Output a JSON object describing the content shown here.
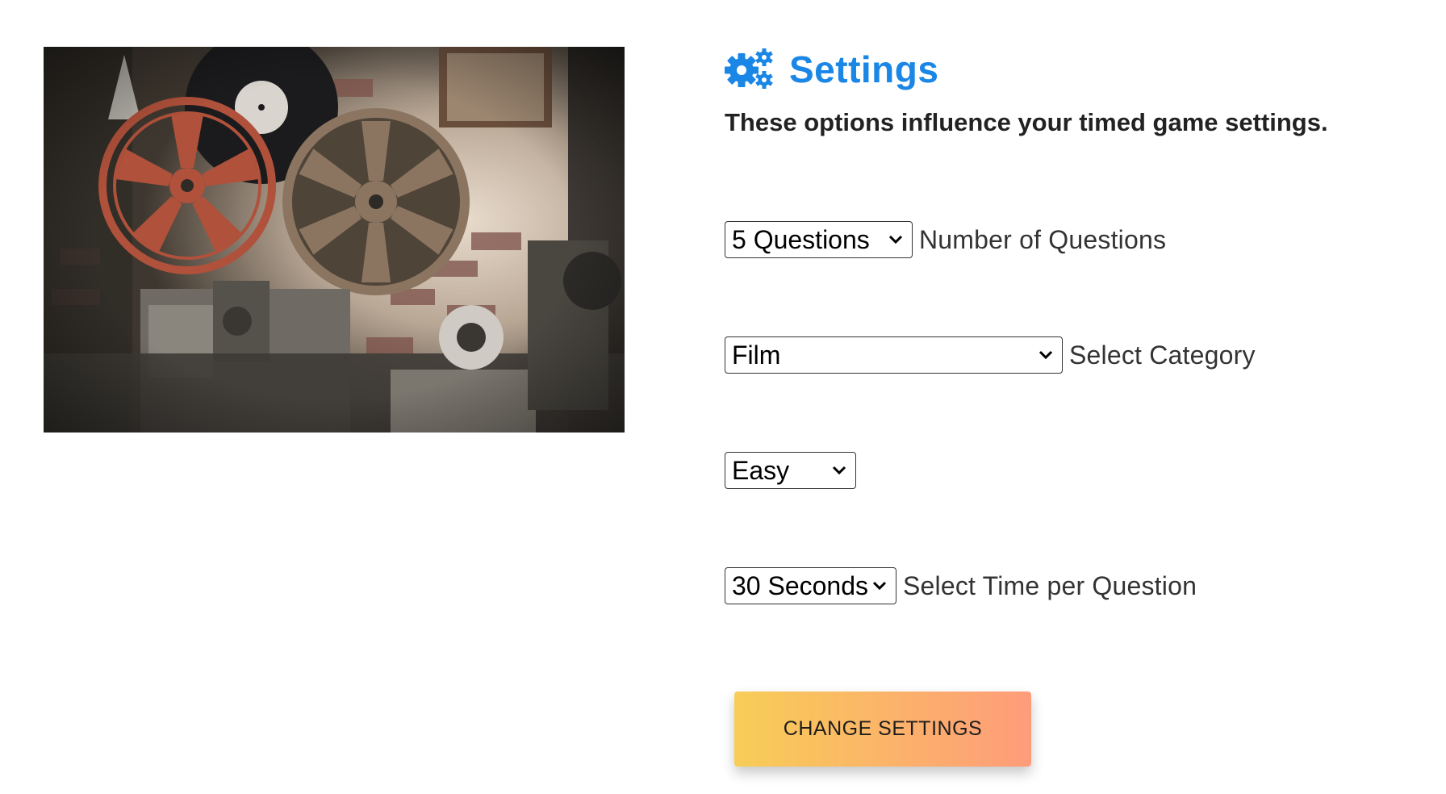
{
  "photo": {
    "alt": "",
    "colors": {
      "wall": "#3b352d",
      "reel_red": "#b0513b",
      "reel_tan": "#8b7561",
      "record": "#1b1b1d"
    }
  },
  "settings": {
    "icon": "gears-icon",
    "title": "Settings",
    "subtitle": "These options influence your timed game settings.",
    "accent_color": "#1a86e6",
    "number_of_questions": {
      "selected": "5 Questions",
      "label": "Number of Questions"
    },
    "category": {
      "selected": "Film",
      "label": "Select Category"
    },
    "difficulty": {
      "selected": "Easy",
      "label": ""
    },
    "time_per_question": {
      "selected": "30 Seconds",
      "label": "Select Time per Question"
    },
    "button": {
      "label": "CHANGE SETTINGS",
      "gradient": [
        "#f8cd57",
        "#fe9c7a"
      ]
    }
  }
}
